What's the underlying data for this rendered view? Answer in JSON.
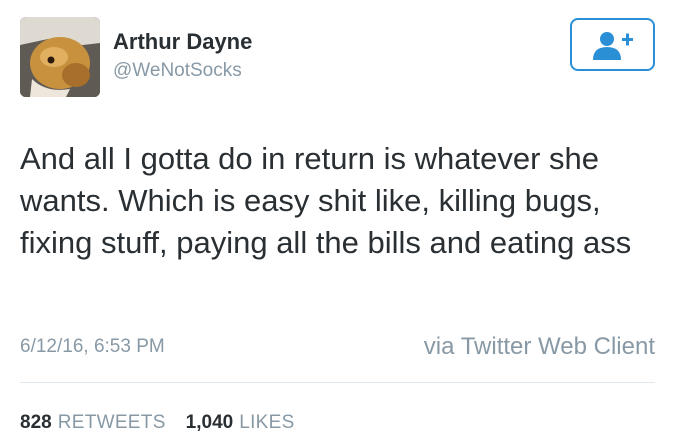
{
  "user": {
    "display_name": "Arthur Dayne",
    "handle": "@WeNotSocks"
  },
  "follow_button": {
    "icon": "add-user-icon",
    "color": "#2b8fd6"
  },
  "tweet": {
    "text": "And all I gotta do in return is whatever she wants. Which is easy shit like, killing bugs, fixing stuff, paying all the bills and eating ass",
    "timestamp": "6/12/16, 6:53 PM",
    "source": "via Twitter Web Client"
  },
  "stats": {
    "retweets_count": "828",
    "retweets_label": "RETWEETS",
    "likes_count": "1,040",
    "likes_label": "LIKES"
  }
}
